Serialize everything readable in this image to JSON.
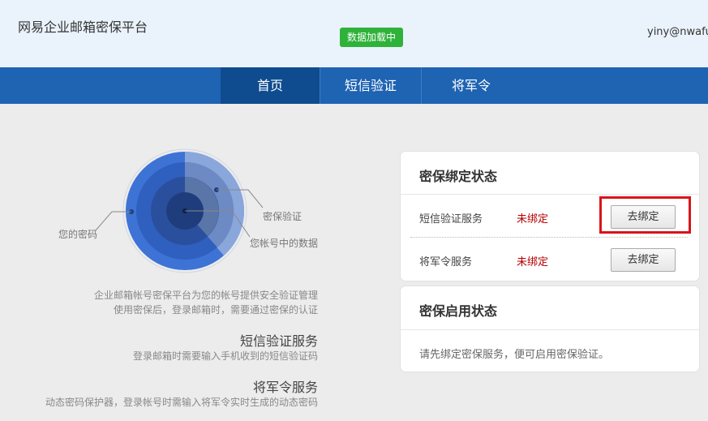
{
  "header": {
    "app_title": "网易企业邮箱密保平台",
    "loading_badge": "数据加载中",
    "user_email": "yiny@nwafu.e"
  },
  "nav": {
    "tabs": [
      {
        "label": "首页",
        "active": true
      },
      {
        "label": "短信验证",
        "active": false
      },
      {
        "label": "将军令",
        "active": false
      }
    ]
  },
  "diagram": {
    "label_password": "您的密码",
    "label_security": "密保验证",
    "label_data": "您帐号中的数据"
  },
  "intro": {
    "line1": "企业邮箱帐号密保平台为您的帐号提供安全验证管理",
    "line2": "使用密保后，登录邮箱时，需要通过密保的认证"
  },
  "services": [
    {
      "title": "短信验证服务",
      "desc": "登录邮箱时需要输入手机收到的短信验证码"
    },
    {
      "title": "将军令服务",
      "desc": "动态密码保护器，登录帐号时需输入将军令实时生成的动态密码"
    }
  ],
  "binding_card": {
    "title": "密保绑定状态",
    "rows": [
      {
        "label": "短信验证服务",
        "status": "未绑定",
        "button": "去绑定"
      },
      {
        "label": "将军令服务",
        "status": "未绑定",
        "button": "去绑定"
      }
    ]
  },
  "enable_card": {
    "title": "密保启用状态",
    "hint": "请先绑定密保服务，便可启用密保验证。"
  },
  "colors": {
    "nav_bg": "#1f63b3",
    "nav_active": "#0f4b8f",
    "badge_green": "#2fb23a",
    "status_red": "#b30000",
    "highlight_red": "#d9141b"
  }
}
